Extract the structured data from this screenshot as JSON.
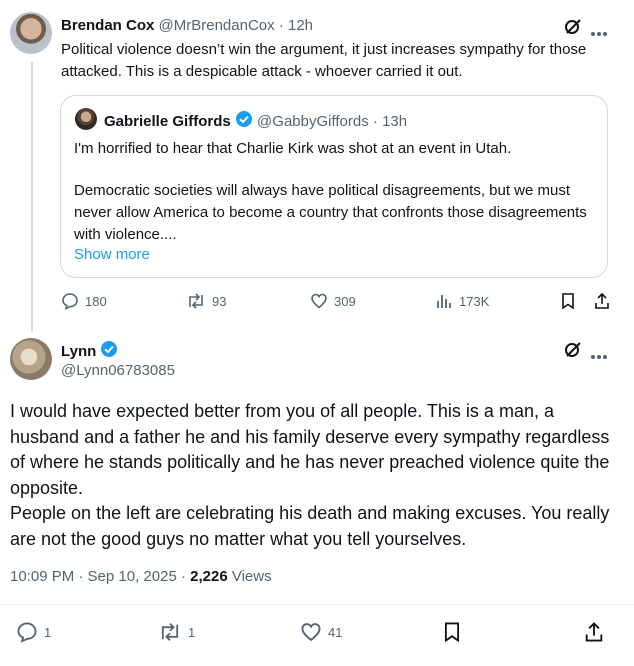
{
  "tweet1": {
    "name": "Brendan Cox",
    "handle": "@MrBrendanCox",
    "separator": "·",
    "time": "12h",
    "text": "Political violence doesn’t win the argument, it just increases sympathy for those attacked. This is a despicable attack - whoever carried it out.",
    "quote": {
      "name": "Gabrielle Giffords",
      "handle": "@GabbyGiffords",
      "time": "13h",
      "line1": "I'm horrified to hear that Charlie Kirk was shot at an event in Utah.",
      "para2": "Democratic societies will always have political disagreements, but we must never allow America to become a country that confronts those disagreements with violence....",
      "show_more": "Show more"
    },
    "stats": {
      "replies": "180",
      "reposts": "93",
      "likes": "309",
      "views": "173K"
    }
  },
  "tweet2": {
    "name": "Lynn",
    "handle": "@Lynn06783085",
    "text": "I would have expected better from you of all people. This is a man, a husband and a father he and his family deserve every sympathy regardless of where he stands politically and he has never preached violence quite the opposite.\nPeople on the left are celebrating his death and making excuses. You really are not the good guys no matter what you tell yourselves.",
    "timestamp": "10:09 PM · Sep 10, 2025 · ",
    "views_count": "2,226",
    "views_label": " Views",
    "stats": {
      "replies": "1",
      "reposts": "1",
      "likes": "41"
    }
  },
  "colors": {
    "text": "#0f1419",
    "muted": "#536471",
    "link": "#1d9bf0",
    "border": "#cfd9de",
    "verified": "#1d9bf0"
  },
  "icons": [
    "grok-icon",
    "more-icon",
    "reply-icon",
    "repost-icon",
    "like-icon",
    "views-icon",
    "bookmark-icon",
    "share-icon",
    "verified-badge-icon"
  ]
}
